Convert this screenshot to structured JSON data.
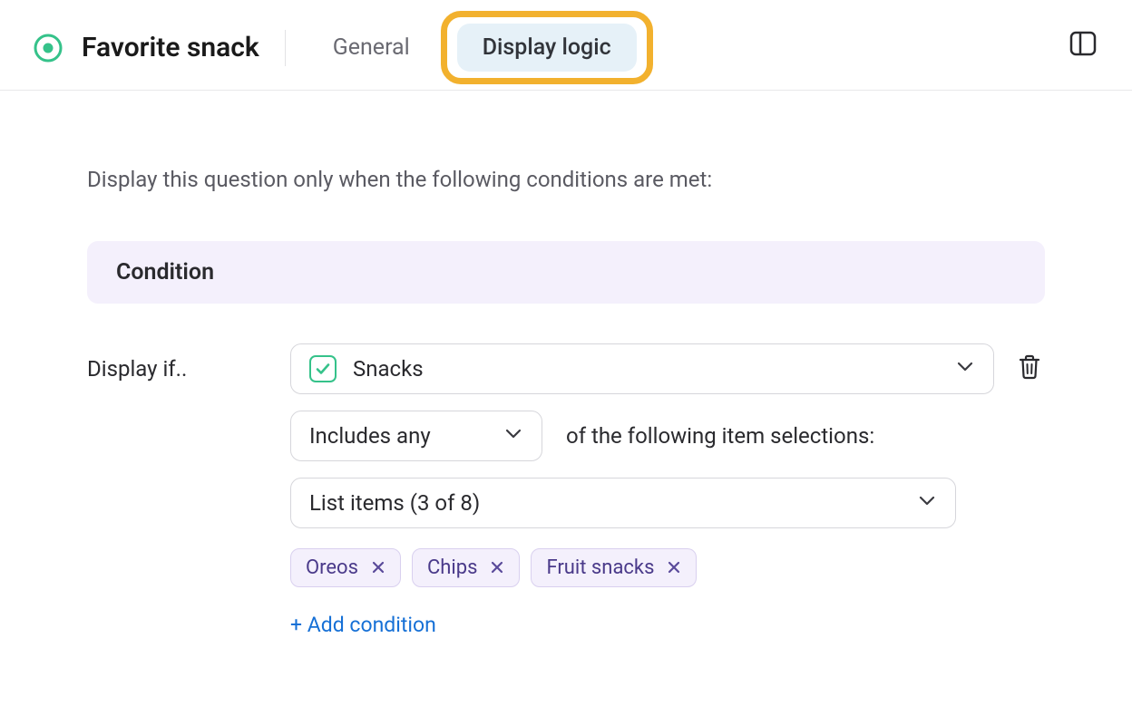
{
  "header": {
    "title": "Favorite snack",
    "tabs": {
      "general": "General",
      "display_logic": "Display logic"
    }
  },
  "main": {
    "intro": "Display this question only when the following conditions are met:",
    "condition_header": "Condition",
    "display_if_label": "Display if..",
    "field_select_value": "Snacks",
    "operator_select_value": "Includes any",
    "operator_suffix_text": "of the following item selections:",
    "items_select_value": "List items (3 of 8)",
    "tags": [
      "Oreos",
      "Chips",
      "Fruit snacks"
    ],
    "add_condition_label": "+ Add condition"
  },
  "icons": {
    "radio": "radio-icon",
    "panel": "panel-icon",
    "chevron": "chevron-down-icon",
    "checkbox": "checkbox-icon",
    "trash": "trash-icon",
    "close": "close-icon"
  },
  "colors": {
    "accent_green": "#35c28a",
    "tab_active_bg": "#e6f1f8",
    "highlight_ring": "#f2b12e",
    "condition_bg": "#f4f0fc",
    "tag_bg": "#f4f0fc",
    "tag_border": "#d9d0ef",
    "tag_text": "#4a3a8a",
    "link": "#1670d6"
  }
}
